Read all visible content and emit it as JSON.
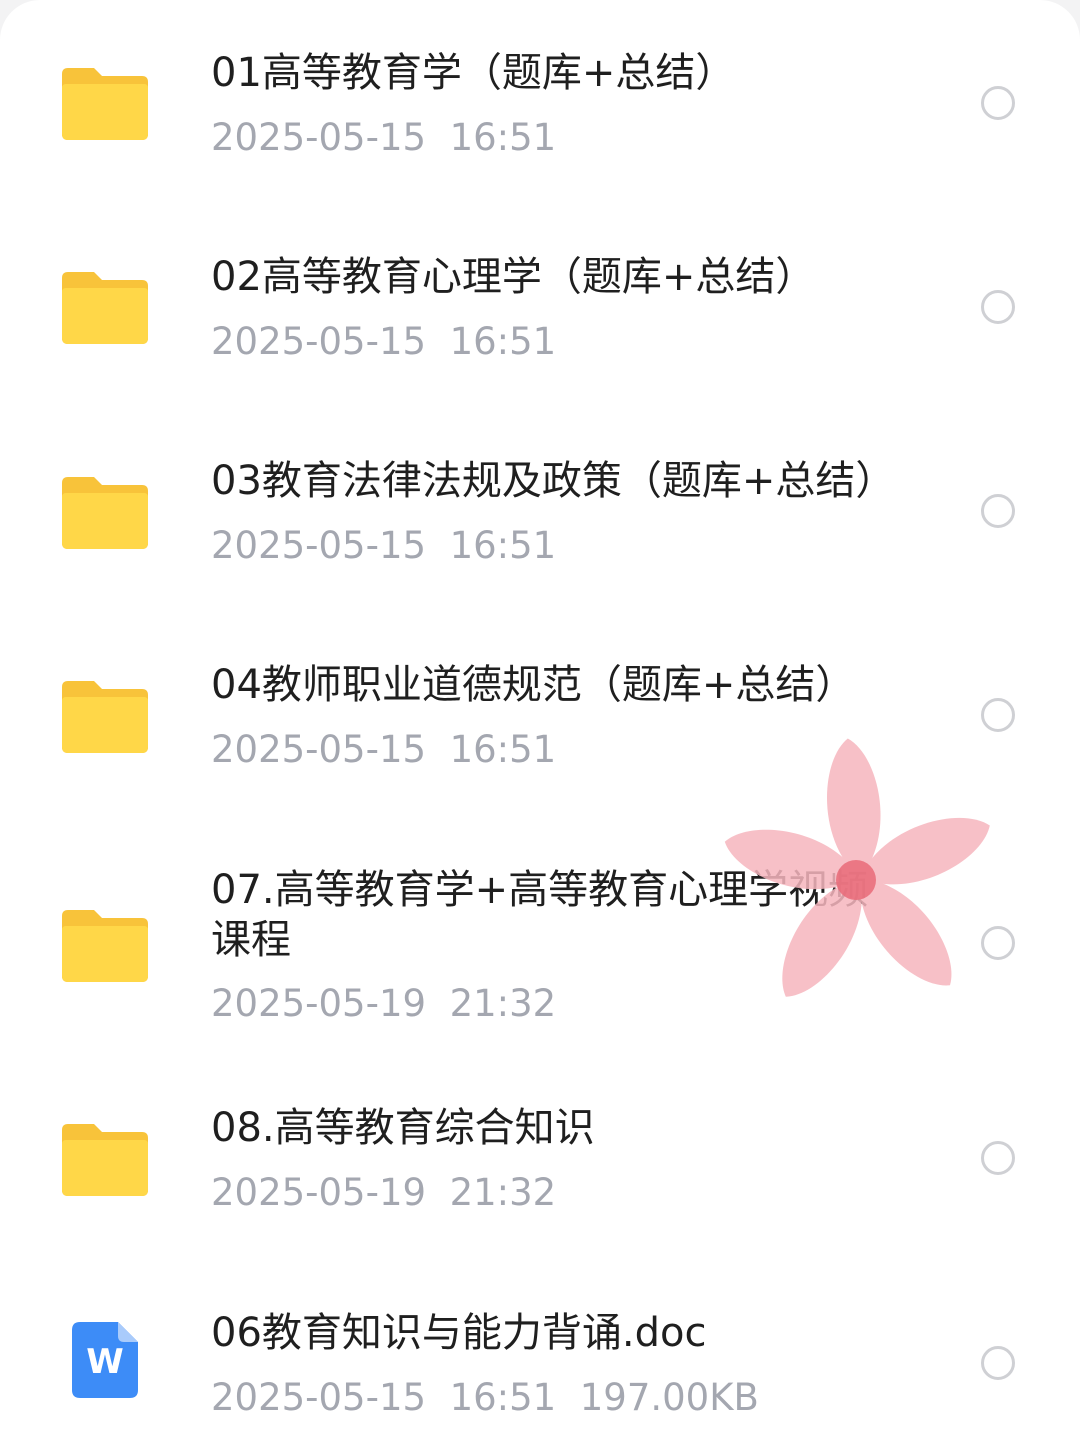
{
  "files": [
    {
      "name": "01高等教育学（题库+总结）",
      "date": "2025-05-15",
      "time": "16:51",
      "size": "",
      "type_icon": "folder-icon"
    },
    {
      "name": "02高等教育心理学（题库+总结）",
      "date": "2025-05-15",
      "time": "16:51",
      "size": "",
      "type_icon": "folder-icon"
    },
    {
      "name": "03教育法律法规及政策（题库+总结）",
      "date": "2025-05-15",
      "time": "16:51",
      "size": "",
      "type_icon": "folder-icon"
    },
    {
      "name": "04教师职业道德规范（题库+总结）",
      "date": "2025-05-15",
      "time": "16:51",
      "size": "",
      "type_icon": "folder-icon"
    },
    {
      "name": "07.高等教育学+高等教育心理学视频课程",
      "date": "2025-05-19",
      "time": "21:32",
      "size": "",
      "type_icon": "folder-icon"
    },
    {
      "name": "08.高等教育综合知识",
      "date": "2025-05-19",
      "time": "21:32",
      "size": "",
      "type_icon": "folder-icon"
    },
    {
      "name": "06教育知识与能力背诵.doc",
      "date": "2025-05-15",
      "time": "16:51",
      "size": "197.00KB",
      "type_icon": "word-doc-icon",
      "doc_badge": "W"
    }
  ],
  "colors": {
    "folder_back": "#F8C33A",
    "folder_front": "#FFD748",
    "word_blue": "#3D8CF7",
    "name_text": "#1F1F1F",
    "meta_text": "#A4A7B0",
    "radio_border": "#CFD0D4",
    "flower_petal": "#F6B6BE",
    "flower_center": "#E96A78"
  }
}
